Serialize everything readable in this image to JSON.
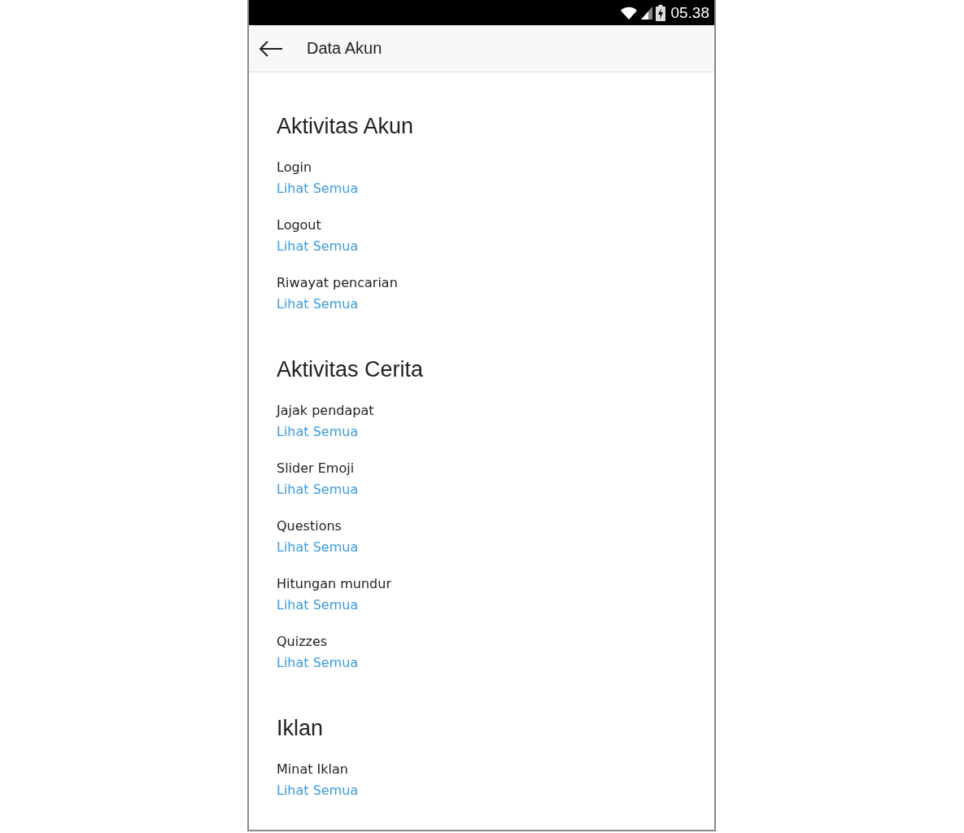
{
  "status_bar": {
    "time": "05.38"
  },
  "app_bar": {
    "title": "Data Akun"
  },
  "sections": [
    {
      "title": "Aktivitas Akun",
      "items": [
        {
          "label": "Login",
          "link": "Lihat Semua"
        },
        {
          "label": "Logout",
          "link": "Lihat Semua"
        },
        {
          "label": "Riwayat pencarian",
          "link": "Lihat Semua"
        }
      ]
    },
    {
      "title": "Aktivitas Cerita",
      "items": [
        {
          "label": "Jajak pendapat",
          "link": "Lihat Semua"
        },
        {
          "label": "Slider Emoji",
          "link": "Lihat Semua"
        },
        {
          "label": "Questions",
          "link": "Lihat Semua"
        },
        {
          "label": "Hitungan mundur",
          "link": "Lihat Semua"
        },
        {
          "label": "Quizzes",
          "link": "Lihat Semua"
        }
      ]
    },
    {
      "title": "Iklan",
      "items": [
        {
          "label": "Minat Iklan",
          "link": "Lihat Semua"
        }
      ]
    }
  ]
}
